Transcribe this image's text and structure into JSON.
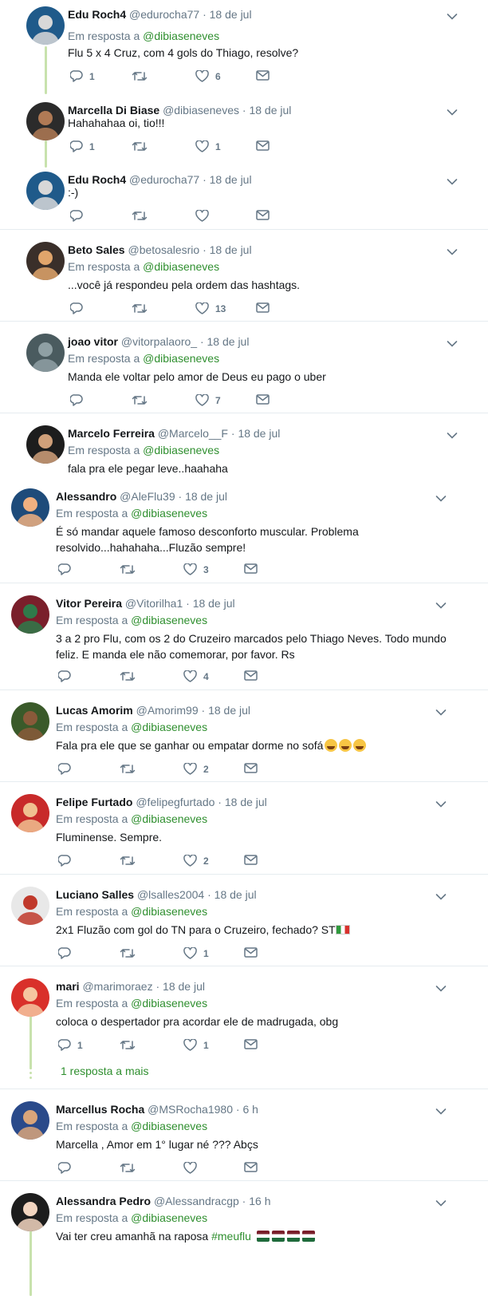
{
  "reply_prefix": "Em resposta a",
  "mention": "@dibiaseneves",
  "tweets": [
    {
      "name": "Edu Roch4",
      "handle": "@edurocha77",
      "time": "18 de jul",
      "reply": true,
      "text": "Flu 5 x 4 Cruz, com 4 gols do Thiago, resolve?",
      "replies": "1",
      "retweets": "",
      "likes": "6"
    },
    {
      "name": "Marcella Di Biase",
      "handle": "@dibiaseneves",
      "time": "18 de jul",
      "reply": false,
      "text": "Hahahahaa oi, tio!!!",
      "replies": "1",
      "retweets": "",
      "likes": "1"
    },
    {
      "name": "Edu Roch4",
      "handle": "@edurocha77",
      "time": "18 de jul",
      "reply": false,
      "text": ":-)",
      "replies": "",
      "retweets": "",
      "likes": ""
    },
    {
      "name": "Beto Sales",
      "handle": "@betosalesrio",
      "time": "18 de jul",
      "reply": true,
      "text": "...você já respondeu pela ordem das hashtags.",
      "replies": "",
      "retweets": "",
      "likes": "13"
    },
    {
      "name": "joao vitor",
      "handle": "@vitorpalaoro_",
      "time": "18 de jul",
      "reply": true,
      "text": "Manda ele voltar pelo amor de Deus eu pago o uber",
      "replies": "",
      "retweets": "",
      "likes": "7"
    },
    {
      "name": "Marcelo Ferreira",
      "handle": "@Marcelo__F",
      "time": "18 de jul",
      "reply": true,
      "text": "fala pra ele pegar leve..haahaha",
      "replies": "",
      "retweets": "",
      "likes": ""
    },
    {
      "name": "Alessandro",
      "handle": "@AleFlu39",
      "time": "18 de jul",
      "reply": true,
      "text": "É só mandar aquele famoso desconforto muscular. Problema resolvido...hahahaha...Fluzão sempre!",
      "replies": "",
      "retweets": "",
      "likes": "3"
    },
    {
      "name": "Vitor Pereira",
      "handle": "@Vitorilha1",
      "time": "18 de jul",
      "reply": true,
      "text": "3 a 2 pro Flu, com os 2 do Cruzeiro marcados pelo Thiago Neves. Todo mundo feliz. E manda ele não comemorar, por favor. Rs",
      "replies": "",
      "retweets": "",
      "likes": "4"
    },
    {
      "name": "Lucas Amorim",
      "handle": "@Amorim99",
      "time": "18 de jul",
      "reply": true,
      "text": "Fala pra ele que se ganhar ou empatar dorme no sofá",
      "replies": "",
      "retweets": "",
      "likes": "2"
    },
    {
      "name": "Felipe Furtado",
      "handle": "@felipegfurtado",
      "time": "18 de jul",
      "reply": true,
      "text": "Fluminense. Sempre.",
      "replies": "",
      "retweets": "",
      "likes": "2"
    },
    {
      "name": "Luciano Salles",
      "handle": "@lsalles2004",
      "time": "18 de jul",
      "reply": true,
      "text": "2x1 Fluzão com gol do TN para o Cruzeiro, fechado? ST",
      "replies": "",
      "retweets": "",
      "likes": "1"
    },
    {
      "name": "mari",
      "handle": "@marimoraez",
      "time": "18 de jul",
      "reply": true,
      "text": "coloca o despertador pra acordar ele de madrugada, obg",
      "replies": "1",
      "retweets": "",
      "likes": "1"
    },
    {
      "name": "Marcellus Rocha",
      "handle": "@MSRocha1980",
      "time": "6 h",
      "reply": true,
      "text": "Marcella , Amor em 1° lugar né ??? Abçs",
      "replies": "",
      "retweets": "",
      "likes": ""
    },
    {
      "name": "Alessandra Pedro",
      "handle": "@Alessandracgp",
      "time": "16 h",
      "reply": true,
      "text": "Vai ter creu amanhã na raposa",
      "hashtag": "#meuflu",
      "replies": "",
      "retweets": "",
      "likes": ""
    }
  ],
  "more_replies": "1 resposta a mais",
  "colors": {
    "accent": "#2f8f2f",
    "thread_line": "#c8e2ad",
    "muted": "#657786"
  }
}
